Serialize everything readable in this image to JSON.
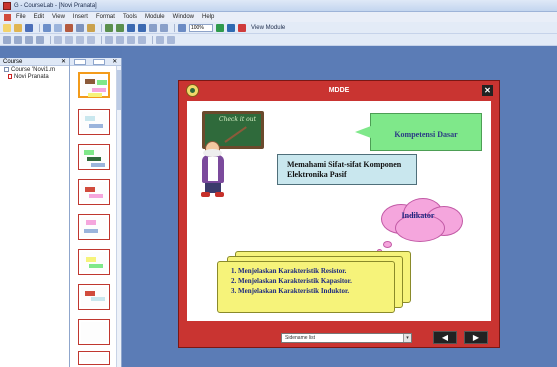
{
  "window": {
    "title": "G - CourseLab - [Novi Pranata]"
  },
  "menu": [
    "File",
    "Edit",
    "View",
    "Insert",
    "Format",
    "Tools",
    "Module",
    "Window",
    "Help"
  ],
  "toolbar": {
    "zoom": "100%",
    "view_module": "View Module"
  },
  "left_panel": {
    "title": "Course",
    "items": [
      {
        "label": "Course 'Novi1.m"
      },
      {
        "label": "Novi Pranata"
      }
    ]
  },
  "slide": {
    "title": "MDDE",
    "chalkboard": "Check it out",
    "kompetensi": "Kompetensi Dasar",
    "sifat": "Memahami Sifat-sifat Komponen Elektronika Pasif",
    "indikator": "Indikator",
    "list": [
      "1. Menjelaskan Karakteristik Resistor.",
      "2. Menjelaskan Karakteristik Kapasitor.",
      "3. Menjelaskan Karakteristik Induktor."
    ],
    "select_value": "Sidename list",
    "close_symbol": "✕",
    "prev_symbol": "◀",
    "next_symbol": "▶"
  },
  "colors": {
    "frame": "#c93431",
    "kompetensi_bg": "#7fe88a",
    "cloud_bg": "#f5a6dd",
    "scroll_bg": "#f6f37a"
  }
}
